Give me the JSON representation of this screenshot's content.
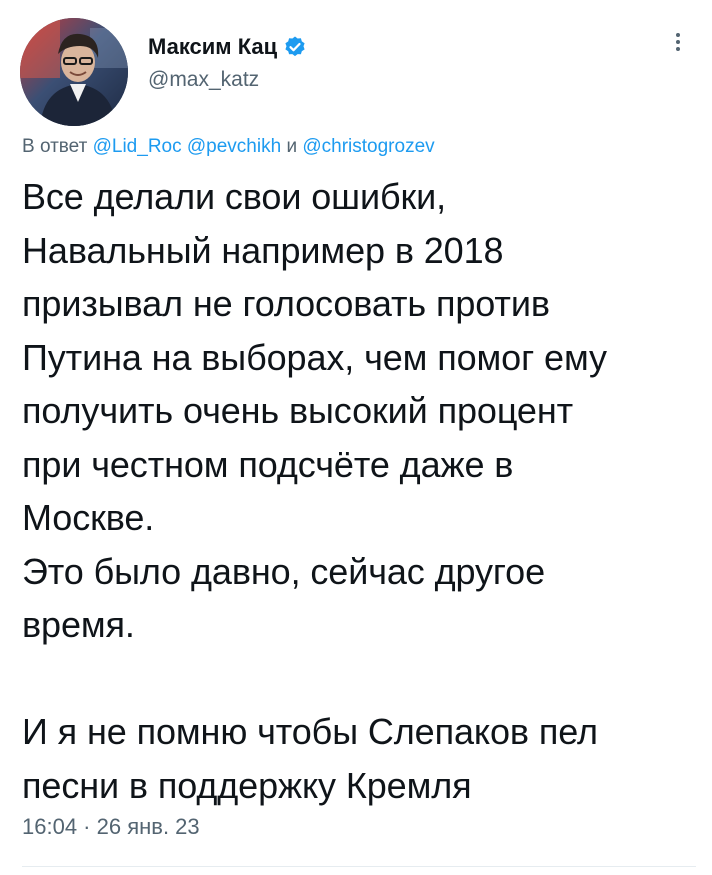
{
  "author": {
    "display_name": "Максим Кац",
    "handle": "@max_katz",
    "verified": true,
    "verified_color": "#1d9bf0"
  },
  "reply": {
    "prefix": "В ответ",
    "mention1": "@Lid_Roc",
    "mention2": "@pevchikh",
    "conjunction": "и",
    "mention3": "@christogrozev"
  },
  "tweet": {
    "lines": [
      "Все делали свои ошибки,",
      "Навальный например в 2018",
      "призывал не голосовать против",
      "Путина на выборах, чем помог ему",
      "получить очень высокий процент",
      "при честном подсчёте даже в",
      "Москве.",
      "Это было давно, сейчас другое",
      "время.",
      "",
      "И я не помню чтобы Слепаков пел",
      "песни в поддержку Кремля"
    ]
  },
  "timestamp": "16:04 · 26 янв. 23",
  "icons": {
    "verified": "verified-badge-icon",
    "more": "more-options-icon"
  },
  "colors": {
    "link": "#1d9bf0",
    "secondary_text": "#536471",
    "primary_text": "#0f1419"
  }
}
